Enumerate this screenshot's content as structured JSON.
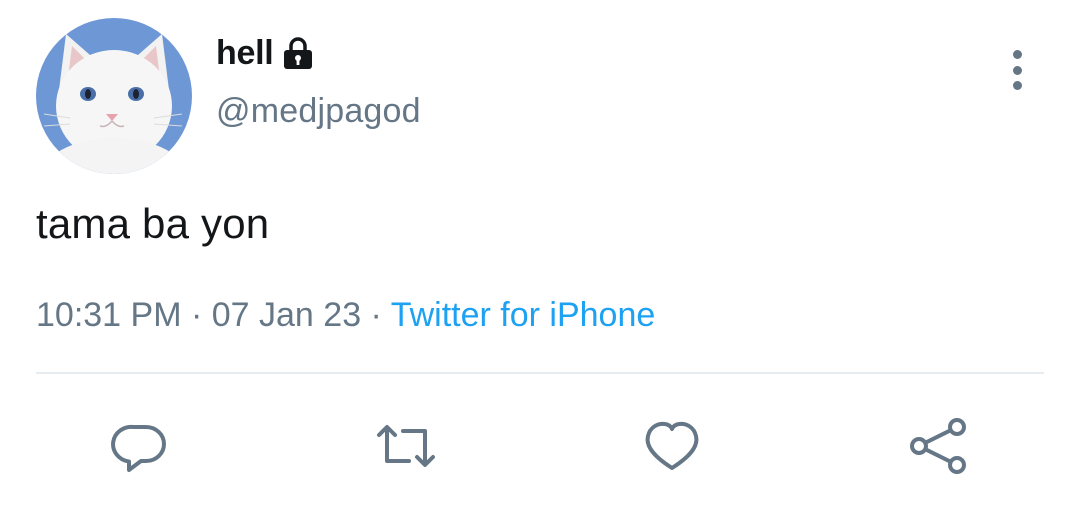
{
  "user": {
    "display_name": "hell",
    "handle": "@medjpagod",
    "protected": true,
    "avatar_icon": "white-cat-avatar"
  },
  "tweet": {
    "text": "tama ba yon",
    "time": "10:31 PM",
    "separator": " · ",
    "date": "07 Jan 23",
    "source": "Twitter for iPhone"
  },
  "actions": {
    "reply_icon": "reply-icon",
    "retweet_icon": "retweet-icon",
    "like_icon": "heart-icon",
    "share_icon": "share-icon"
  },
  "colors": {
    "text": "#14171a",
    "secondary": "#657786",
    "link": "#1da1f2",
    "divider": "#e6ecf0",
    "avatar_bg": "#6e97d6"
  }
}
